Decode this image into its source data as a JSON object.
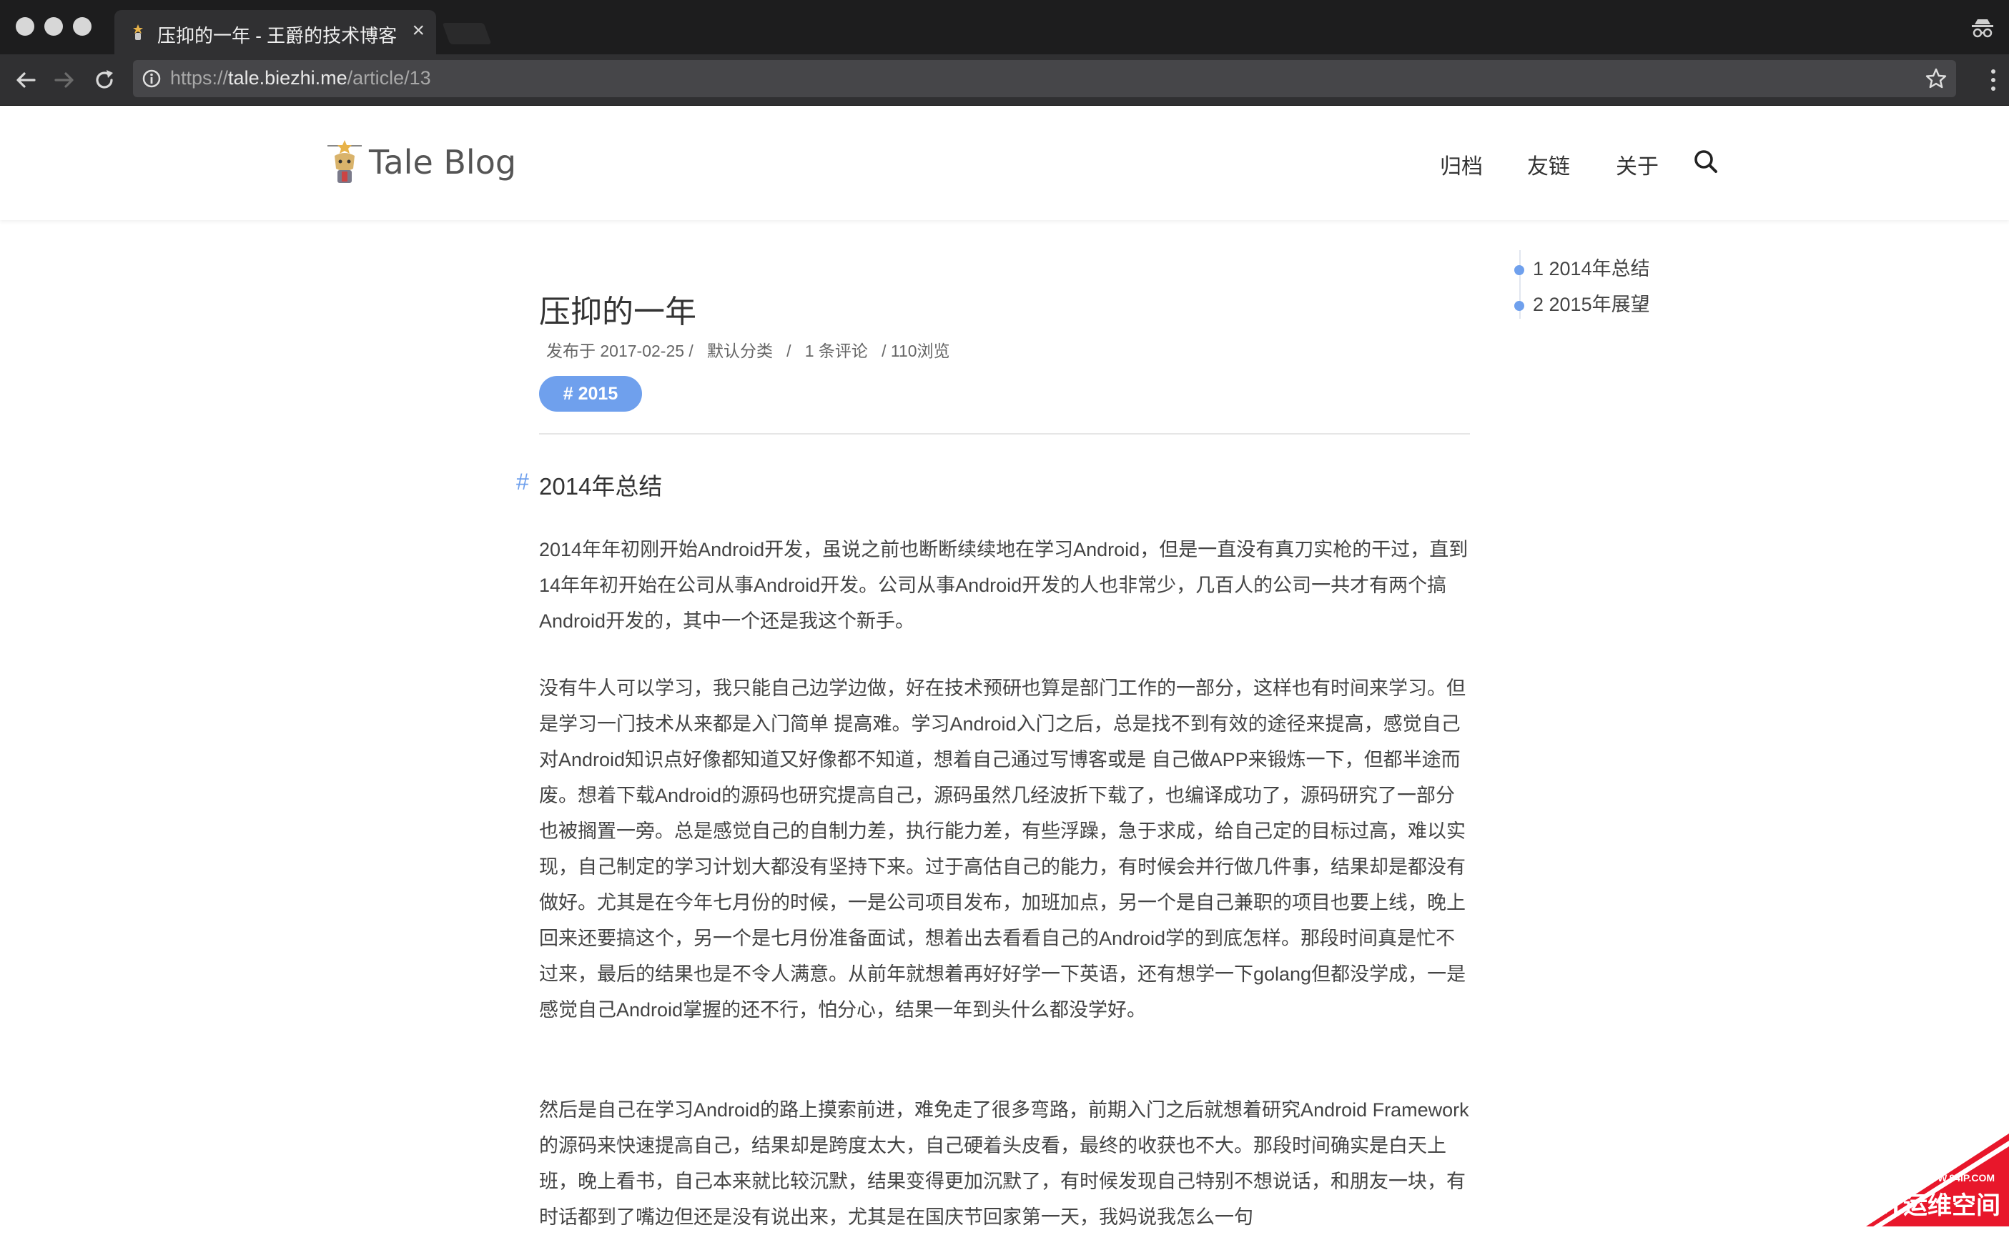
{
  "browser": {
    "tab_title": "压抑的一年 - 王爵的技术博客",
    "tab_close": "×",
    "url_scheme": "https://",
    "url_host": "tale.biezhi.me",
    "url_path": "/article/13"
  },
  "site": {
    "logo_text": "Tale Blog",
    "nav": [
      "归档",
      "友链",
      "关于"
    ]
  },
  "article": {
    "title": "压抑的一年",
    "meta": "发布于 2017-02-25 /   默认分类   /   1 条评论   / 110浏览",
    "tag": "# 2015",
    "heading": "2014年总结",
    "heading_hash": "#",
    "paragraphs": [
      "2014年年初刚开始Android开发，虽说之前也断断续续地在学习Android，但是一直没有真刀实枪的干过，直到14年年初开始在公司从事Android开发。公司从事Android开发的人也非常少，几百人的公司一共才有两个搞Android开发的，其中一个还是我这个新手。",
      "没有牛人可以学习，我只能自己边学边做，好在技术预研也算是部门工作的一部分，这样也有时间来学习。但是学习一门技术从来都是入门简单 提高难。学习Android入门之后，总是找不到有效的途径来提高，感觉自己对Android知识点好像都知道又好像都不知道，想着自己通过写博客或是 自己做APP来锻炼一下，但都半途而废。想着下载Android的源码也研究提高自己，源码虽然几经波折下载了，也编译成功了，源码研究了一部分也被搁置一旁。总是感觉自己的自制力差，执行能力差，有些浮躁，急于求成，给自己定的目标过高，难以实现，自己制定的学习计划大都没有坚持下来。过于高估自己的能力，有时候会并行做几件事，结果却是都没有做好。尤其是在今年七月份的时候，一是公司项目发布，加班加点，另一个是自己兼职的项目也要上线，晚上回来还要搞这个，另一个是七月份准备面试，想着出去看看自己的Android学的到底怎样。那段时间真是忙不过来，最后的结果也是不令人满意。从前年就想着再好好学一下英语，还有想学一下golang但都没学成，一是感觉自己Android掌握的还不行，怕分心，结果一年到头什么都没学好。",
      "然后是自己在学习Android的路上摸索前进，难免走了很多弯路，前期入门之后就想着研究Android Framework的源码来快速提高自己，结果却是跨度太大，自己硬着头皮看，最终的收获也不大。那段时间确实是白天上班，晚上看书，自己本来就比较沉默，结果变得更加沉默了，有时候发现自己特别不想说话，和朋友一块，有时话都到了嘴边但还是没有说出来，尤其是在国庆节回家第一天，我妈说我怎么一句"
    ]
  },
  "toc": [
    "1 2014年总结",
    "2 2015年展望"
  ],
  "watermark": {
    "small": "WWW.94IP.COM",
    "big": "IT运维空间"
  },
  "colors": {
    "accent": "#6fa0ed",
    "chrome_dark": "#1d1d1e",
    "watermark_red": "#e8172b"
  }
}
